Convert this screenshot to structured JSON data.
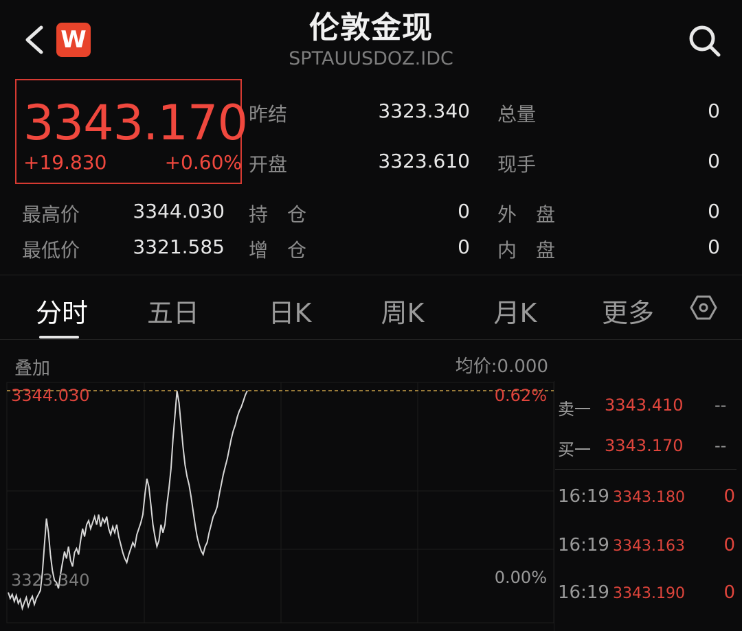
{
  "header": {
    "title": "伦敦金现",
    "subtitle": "SPTAUUSDOZ.IDC",
    "logo_letter": "W",
    "icons": {
      "back": "back-arrow-icon",
      "search": "search-icon",
      "settings": "settings-hexagon-icon"
    }
  },
  "quote": {
    "price": "3343.170",
    "change": "+19.830",
    "change_pct": "+0.60%",
    "color_up": "#f0483e"
  },
  "stats": {
    "prev_settle_label": "昨结",
    "prev_settle": "3323.340",
    "open_label": "开盘",
    "open": "3323.610",
    "total_vol_label": "总量",
    "total_vol": "0",
    "cur_vol_label": "现手",
    "cur_vol": "0",
    "high_label": "最高价",
    "high": "3344.030",
    "low_label": "最低价",
    "low": "3321.585",
    "open_interest_label": "持　仓",
    "open_interest": "0",
    "oi_change_label": "增　仓",
    "oi_change": "0",
    "outer_label": "外　盘",
    "outer": "0",
    "inner_label": "内　盘",
    "inner": "0"
  },
  "tabs": [
    {
      "label": "分时",
      "active": true
    },
    {
      "label": "五日"
    },
    {
      "label": "日K"
    },
    {
      "label": "周K"
    },
    {
      "label": "月K"
    },
    {
      "label": "更多"
    }
  ],
  "chart_meta": {
    "overlay_label": "叠加",
    "avg_price": "均价:0.000",
    "high_label": "3344.030",
    "high_pct": "0.62%",
    "base_label": "3323.340",
    "base_pct": "0.00%"
  },
  "chart_data": {
    "type": "line",
    "y_range": [
      3321.585,
      3344.03
    ],
    "baseline": 3323.34,
    "x": [
      0,
      4,
      8,
      12,
      16,
      20,
      24,
      28,
      32,
      36,
      40,
      44,
      48,
      52,
      56,
      60,
      64,
      68,
      72,
      76,
      80,
      84,
      88,
      92,
      96,
      100,
      104,
      108,
      112,
      116,
      120,
      124,
      128,
      132,
      136,
      140,
      144,
      148,
      152,
      156,
      160,
      164,
      168,
      172,
      176,
      180,
      184,
      188,
      192,
      196,
      200,
      204,
      208,
      212,
      216,
      220,
      224,
      228,
      232,
      236,
      240,
      244,
      248,
      252,
      256,
      260,
      264,
      268,
      272,
      276,
      280,
      284,
      288,
      292,
      296,
      300,
      304,
      308,
      312,
      316,
      320,
      324,
      328,
      332,
      336,
      340,
      344,
      348,
      352,
      356,
      360,
      364,
      368,
      372,
      376,
      380,
      384,
      388,
      392,
      396,
      400,
      404,
      408,
      412,
      416,
      420,
      424,
      428,
      432,
      436,
      440,
      444,
      448,
      452,
      456,
      460,
      464,
      468,
      472,
      476,
      480,
      484,
      488,
      492,
      496,
      500,
      504,
      508,
      512,
      516,
      520,
      524,
      528,
      532,
      536,
      540,
      544,
      548,
      552,
      556,
      560,
      564,
      568,
      572,
      576,
      580,
      584,
      588,
      592,
      596,
      600,
      604,
      608,
      612,
      616,
      620,
      624,
      628,
      632,
      636,
      640,
      644,
      648,
      652,
      656,
      660,
      664,
      668,
      672,
      676,
      680,
      684,
      688,
      692,
      696,
      700,
      704,
      708,
      712,
      716,
      720,
      724,
      728,
      732,
      736,
      740,
      744,
      748,
      752,
      756,
      760,
      764,
      768,
      772,
      776,
      780,
      784,
      788,
      792,
      796,
      800,
      804,
      808,
      812,
      816,
      820,
      824,
      828,
      832,
      836,
      840,
      844,
      848,
      852,
      856,
      860,
      864,
      868,
      872,
      876,
      880,
      884
    ],
    "series": [
      {
        "values": [
          3323.8,
          3323.2,
          3323.6,
          3322.9,
          3323.5,
          3322.7,
          3323.1,
          3322.2,
          3322.8,
          3323.3,
          3322.4,
          3323.0,
          3323.4,
          3322.6,
          3323.2,
          3323.6,
          3324.0,
          3325.8,
          3328.5,
          3331.2,
          3329.8,
          3327.6,
          3326.0,
          3325.0,
          3324.8,
          3324.2,
          3325.6,
          3326.8,
          3327.9,
          3327.2,
          3328.4,
          3327.0,
          3326.4,
          3327.8,
          3328.2,
          3327.6,
          3329.0,
          3330.2,
          3329.4,
          3330.6,
          3331.0,
          3330.2,
          3330.8,
          3331.4,
          3330.6,
          3331.6,
          3330.4,
          3331.2,
          3330.8,
          3331.4,
          3330.2,
          3329.6,
          3330.4,
          3329.8,
          3330.6,
          3329.4,
          3328.6,
          3327.8,
          3327.2,
          3326.8,
          3327.6,
          3328.2,
          3328.8,
          3328.4,
          3329.6,
          3330.2,
          3330.8,
          3331.6,
          3333.6,
          3335.2,
          3334.4,
          3332.6,
          3330.6,
          3329.4,
          3328.4,
          3329.0,
          3330.6,
          3329.8,
          3330.6,
          3332.6,
          3334.2,
          3336.2,
          3339.2,
          3341.6,
          3344.0,
          3342.8,
          3340.6,
          3338.4,
          3336.6,
          3335.4,
          3334.6,
          3333.4,
          3332.0,
          3330.6,
          3329.4,
          3328.6,
          3328.0,
          3327.6,
          3328.4,
          3328.8,
          3329.8,
          3330.6,
          3331.4,
          3331.8,
          3332.4,
          3333.6,
          3334.6,
          3335.6,
          3336.4,
          3337.2,
          3338.2,
          3339.2,
          3340.0,
          3340.6,
          3341.4,
          3342.0,
          3342.4,
          3343.0,
          3343.6,
          3344.03
        ]
      }
    ]
  },
  "order_book": {
    "ask_label": "卖一",
    "ask_price": "3343.410",
    "ask_vol": "--",
    "bid_label": "买一",
    "bid_price": "3343.170",
    "bid_vol": "--"
  },
  "ticks": [
    {
      "time": "16:19",
      "price": "3343.180",
      "vol": "0"
    },
    {
      "time": "16:19",
      "price": "3343.163",
      "vol": "0"
    },
    {
      "time": "16:19",
      "price": "3343.190",
      "vol": "0"
    }
  ]
}
